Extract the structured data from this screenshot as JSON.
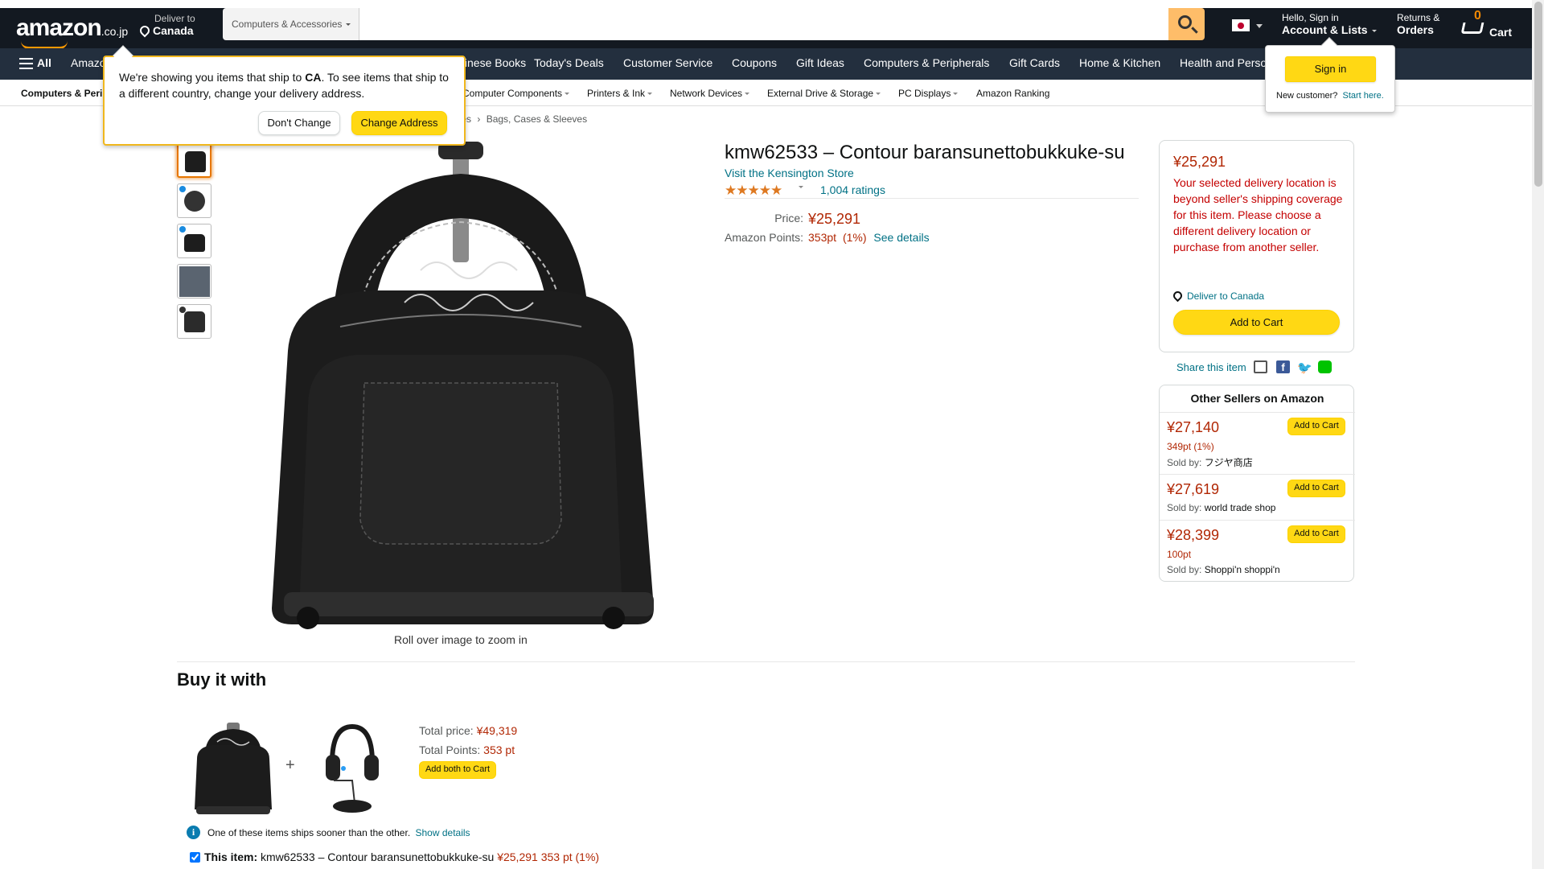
{
  "header": {
    "logo_text": "amazon",
    "logo_tld": ".co.jp",
    "deliver_line1": "Deliver to",
    "deliver_line2": "Canada",
    "search_dept": "Computers & Accessories",
    "search_placeholder": "",
    "account_line1": "Hello, Sign in",
    "account_line2": "Account & Lists",
    "returns_line1": "Returns &",
    "returns_line2": "Orders",
    "cart_count": "0",
    "cart_label": "Cart"
  },
  "nav": {
    "all_label": "All",
    "items": [
      "Amazon",
      "Chinese Books",
      "Today's Deals",
      "Customer Service",
      "Coupons",
      "Gift Ideas",
      "Computers & Peripherals",
      "Gift Cards",
      "Home & Kitchen",
      "Health and Personal Care"
    ]
  },
  "subnav": {
    "items": [
      "Computers & Peripherals",
      "Computer Components",
      "Printers & Ink",
      "Network Devices",
      "External Drive & Storage",
      "PC Displays",
      "Amazon Ranking"
    ]
  },
  "breadcrumb": {
    "items": [
      "ories",
      "Bags, Cases & Sleeves"
    ]
  },
  "delivery_popover": {
    "message_pre": "We're showing you items that ship to ",
    "country": "CA",
    "message_post": ". To see items that ship to a different country, change your delivery address.",
    "dont_change": "Don't Change",
    "change_address": "Change Address"
  },
  "signin_popover": {
    "button": "Sign in",
    "new_customer": "New customer?",
    "start_here": "Start here."
  },
  "product": {
    "title": "kmw62533 – Contour baransunettobukkuke-su",
    "store_link": "Visit the Kensington Store",
    "rating_stars": "★★★★★",
    "rating_count": "1,004 ratings",
    "price_label": "Price:",
    "price": "¥25,291",
    "points_label": "Amazon Points:",
    "points": "353pt",
    "points_pct": "(1%)",
    "see_details": "See details",
    "roll_over": "Roll over image to zoom in"
  },
  "buybox": {
    "price": "¥25,291",
    "warning": "Your selected delivery location is beyond seller's shipping coverage for this item. Please choose a different delivery location or purchase from another seller.",
    "deliver_to": "Deliver to Canada",
    "add_to_cart": "Add to Cart",
    "share_label": "Share this item"
  },
  "other_sellers": {
    "title": "Other Sellers on Amazon",
    "sold_by_label": "Sold by:",
    "add_label": "Add to Cart",
    "items": [
      {
        "price": "¥27,140",
        "points": "349pt (1%)",
        "seller": "フジヤ商店"
      },
      {
        "price": "¥27,619",
        "points": "",
        "seller": "world trade shop"
      },
      {
        "price": "¥28,399",
        "points": "100pt",
        "seller": "Shoppi'n shoppi'n"
      }
    ]
  },
  "buy_it_with": {
    "title": "Buy it with",
    "total_price_label": "Total price:",
    "total_price": "¥49,319",
    "total_points_label": "Total Points:",
    "total_points": "353 pt",
    "add_both": "Add both to Cart",
    "ships_note": "One of these items ships sooner than the other.",
    "show_details": "Show details",
    "this_item_label": "This item:",
    "this_item_name": "kmw62533 – Contour baransunettobukkuke-su",
    "this_item_price": "¥25,291",
    "this_item_points": "353 pt (1%)"
  },
  "colors": {
    "nav_dark": "#131921",
    "nav_secondary": "#232f3e",
    "accent_orange": "#ff9900",
    "button_yellow": "#ffd814",
    "price_red": "#b12704",
    "link_teal": "#007185"
  }
}
